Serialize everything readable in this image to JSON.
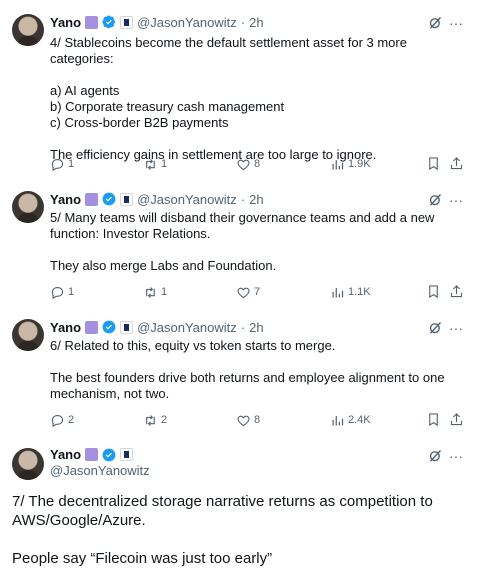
{
  "tweets": [
    {
      "name": "Yano",
      "handle": "@JasonYanowitz",
      "time": "2h",
      "lines": [
        "4/ Stablecoins become the default settlement asset for 3 more categories:",
        "",
        "a) AI agents",
        "b) Corporate treasury cash management",
        "c) Cross-border B2B payments",
        "",
        "The efficiency gains in settlement are too large to ignore."
      ],
      "replies": "1",
      "reposts": "1",
      "likes": "8",
      "views": "1.9K"
    },
    {
      "name": "Yano",
      "handle": "@JasonYanowitz",
      "time": "2h",
      "lines": [
        "5/ Many teams will disband their governance teams and add a new",
        "function: Investor Relations.",
        "",
        "They also merge Labs and Foundation."
      ],
      "replies": "1",
      "reposts": "1",
      "likes": "7",
      "views": "1.1K"
    },
    {
      "name": "Yano",
      "handle": "@JasonYanowitz",
      "time": "2h",
      "lines": [
        "6/ Related to this, equity vs token starts to merge.",
        "",
        "The best founders drive both returns and employee alignment to one",
        "mechanism, not two."
      ],
      "replies": "2",
      "reposts": "2",
      "likes": "8",
      "views": "2.4K"
    }
  ],
  "focused": {
    "name": "Yano",
    "handle": "@JasonYanowitz",
    "lines": [
      "7/ The decentralized storage narrative returns as competition to",
      "AWS/Google/Azure.",
      "",
      "People say “Filecoin was just too early”"
    ]
  },
  "separator": "·",
  "more_glyph": "···",
  "colors": {
    "accent": "#1d9bf0",
    "muted": "#536471",
    "purple_badge": "#a48fe0"
  }
}
